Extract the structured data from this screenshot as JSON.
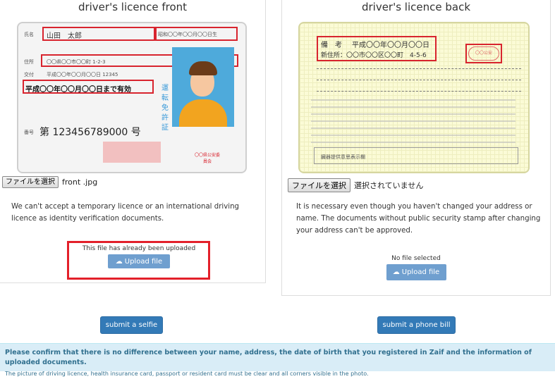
{
  "front": {
    "title": "driver's licence front",
    "choose_label": "ファイルを選択",
    "file_name": "front .jpg",
    "notice": "We can't accept a temporary licence or an international driving licence as identity verification documents.",
    "upload_status": "This file has already been uploaded",
    "upload_label": "Upload file",
    "card": {
      "name_label": "氏名",
      "name_value": "山田　太郎",
      "birth": "昭和〇〇年〇〇月〇〇日生",
      "address_label": "住所",
      "address_value": "〇〇県〇〇市〇〇町 1-2-3",
      "issue_label": "交付",
      "issue_value": "平成〇〇年〇〇月〇〇日 12345",
      "expiry": "平成〇〇年〇〇月〇〇日まで有効",
      "number_label": "番号",
      "number": "第 123456789000 号",
      "type_text": "運転免許証",
      "authority": "〇〇県公安委員会"
    }
  },
  "back": {
    "title": "driver's licence back",
    "choose_label": "ファイルを選択",
    "file_name": "選択されていません",
    "notice": "It is necessary even though you haven't changed your address or name. The documents without public security stamp after changing your address can't be approved.",
    "upload_status": "No file selected",
    "upload_label": "Upload file",
    "card": {
      "remarks_label": "備　考",
      "remarks_value": "平成〇〇年〇〇月〇〇日",
      "new_address": "新住所：〇〇市〇〇区〇〇町　4-5-6",
      "stamp": "〇〇公安",
      "footer": "臓器提供意思表示欄"
    }
  },
  "actions": {
    "selfie": "submit a selfie",
    "phone_bill": "submit a phone bill"
  },
  "info": {
    "text": "Please confirm that there is no difference between your name, address, the date of birth that you registered in Zaif and the information of uploaded documents.",
    "sub": "The picture of driving licence, health insurance card, passport or resident card must be clear and all corners visible in the photo."
  },
  "colors": {
    "highlight": "#e3202a",
    "primary_button": "#337ab7",
    "upload_button": "#6f9fcf",
    "info_bg": "#d9edf7",
    "info_text": "#31708f"
  }
}
